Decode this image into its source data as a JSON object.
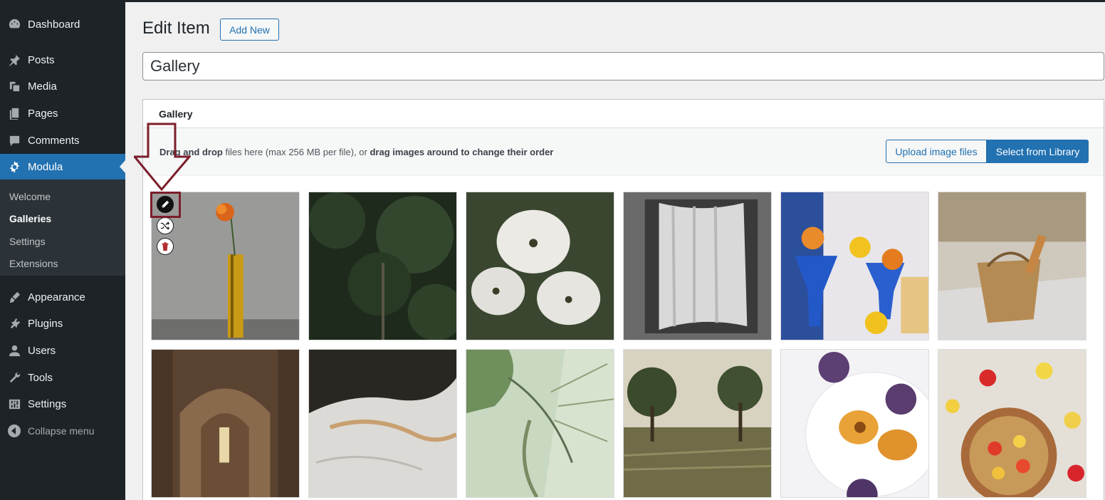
{
  "sidebar": {
    "items": [
      {
        "label": "Dashboard",
        "icon": "dashboard-icon"
      },
      {
        "label": "Posts",
        "icon": "pin-icon"
      },
      {
        "label": "Media",
        "icon": "media-icon"
      },
      {
        "label": "Pages",
        "icon": "pages-icon"
      },
      {
        "label": "Comments",
        "icon": "comments-icon"
      },
      {
        "label": "Modula",
        "icon": "gear-icon"
      },
      {
        "label": "Appearance",
        "icon": "brush-icon"
      },
      {
        "label": "Plugins",
        "icon": "plugin-icon"
      },
      {
        "label": "Users",
        "icon": "user-icon"
      },
      {
        "label": "Tools",
        "icon": "wrench-icon"
      },
      {
        "label": "Settings",
        "icon": "settings-icon"
      }
    ],
    "submenu": [
      "Welcome",
      "Galleries",
      "Settings",
      "Extensions"
    ],
    "collapse_label": "Collapse menu"
  },
  "header": {
    "title": "Edit Item",
    "add_new": "Add New"
  },
  "title_field": {
    "value": "Gallery"
  },
  "gallery_box": {
    "heading": "Gallery",
    "dropzone": {
      "part1": "Drag and drop",
      "part2": " files here (max 256 MB per file), or ",
      "part3": "drag images around to change their order"
    },
    "upload_label": "Upload image files",
    "select_label": "Select from Library"
  },
  "thumbnails": [
    "Orange flower in yellow vase",
    "Dark forest canopy",
    "White dogwood flowers",
    "Curtain by window",
    "Blue glasses with citrus",
    "Wicker bag on dunes",
    "Abbey ruins arches",
    "Bed with white sheets",
    "Palm shadow on wall",
    "Trees in grass field",
    "Plums on white plate",
    "Fruit bowl with granola"
  ],
  "colors": {
    "sidebar_bg": "#1d2327",
    "active_bg": "#2271b1",
    "highlight": "#7b1e2b"
  }
}
